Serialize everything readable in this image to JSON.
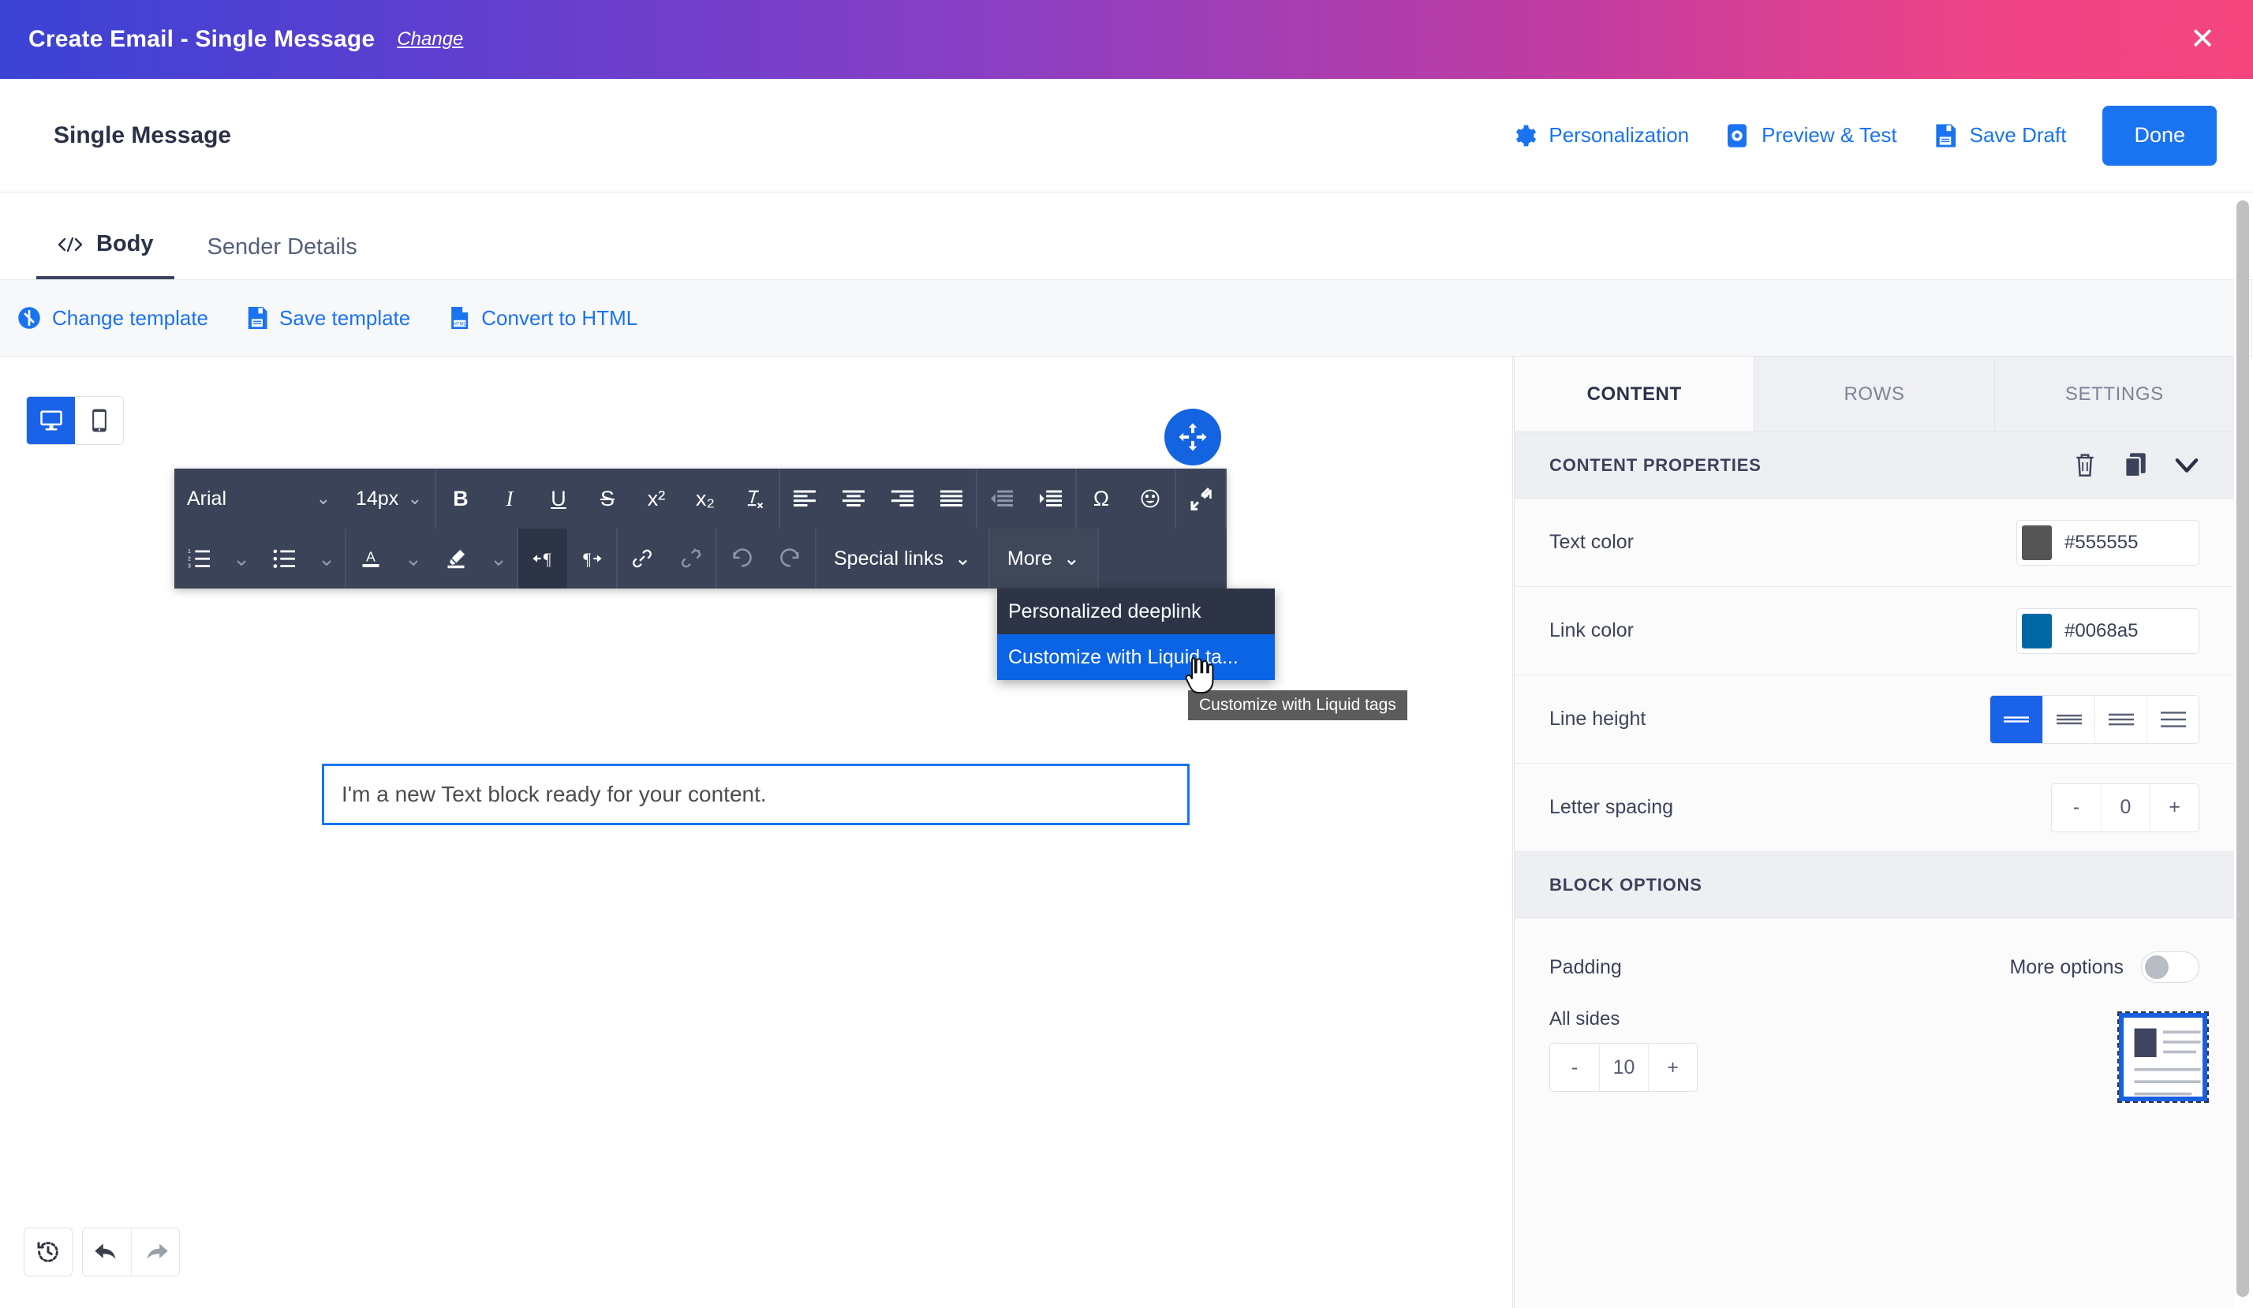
{
  "topbar": {
    "title": "Create Email - Single Message",
    "change_label": "Change",
    "close_icon": "close-icon"
  },
  "actionbar": {
    "title": "Single Message",
    "items": [
      {
        "label": "Personalization",
        "icon": "gear-icon"
      },
      {
        "label": "Preview & Test",
        "icon": "preview-device-icon"
      },
      {
        "label": "Save Draft",
        "icon": "floppy-disk-icon"
      }
    ],
    "done_label": "Done"
  },
  "tabs": [
    {
      "label": "Body",
      "icon": "code-icon",
      "active": true
    },
    {
      "label": "Sender Details",
      "icon": "",
      "active": false
    }
  ],
  "template_bar": [
    {
      "label": "Change template",
      "icon": "refresh-circle-icon"
    },
    {
      "label": "Save template",
      "icon": "floppy-disk-icon"
    },
    {
      "label": "Convert to HTML",
      "icon": "html-file-icon"
    }
  ],
  "canvas": {
    "device_toggle": [
      {
        "name": "desktop",
        "icon": "desktop-icon",
        "active": true
      },
      {
        "name": "mobile",
        "icon": "mobile-icon",
        "active": false
      }
    ],
    "text_block": "I'm a new Text block ready for your content.",
    "drag_handle_icon": "move-arrows-icon",
    "history_icon": "history-clock-icon",
    "undo_icon": "undo-arrow-icon",
    "redo_icon": "redo-arrow-icon"
  },
  "rte": {
    "font_family": "Arial",
    "font_size": "14px",
    "row1": [
      {
        "name": "bold",
        "glyph": "B"
      },
      {
        "name": "italic",
        "glyph": "I"
      },
      {
        "name": "underline",
        "glyph": "U"
      },
      {
        "name": "strikethrough",
        "glyph": "S"
      },
      {
        "name": "superscript",
        "glyph": "x²"
      },
      {
        "name": "subscript",
        "glyph": "x₂"
      },
      {
        "name": "remove-format",
        "glyph": "Ix"
      },
      {
        "name": "align-left",
        "glyph": ""
      },
      {
        "name": "align-center",
        "glyph": ""
      },
      {
        "name": "align-right",
        "glyph": ""
      },
      {
        "name": "align-justify",
        "glyph": ""
      },
      {
        "name": "outdent",
        "glyph": ""
      },
      {
        "name": "indent",
        "glyph": ""
      },
      {
        "name": "special-character",
        "glyph": "Ω"
      },
      {
        "name": "emoji",
        "glyph": "☺"
      },
      {
        "name": "collapse-toolbar",
        "glyph": ""
      }
    ],
    "row2": [
      {
        "name": "ordered-list",
        "glyph": ""
      },
      {
        "name": "ordered-list-options",
        "glyph": "⌄"
      },
      {
        "name": "unordered-list",
        "glyph": ""
      },
      {
        "name": "unordered-list-options",
        "glyph": "⌄"
      },
      {
        "name": "text-color",
        "glyph": "A"
      },
      {
        "name": "text-color-options",
        "glyph": "⌄"
      },
      {
        "name": "highlight-color",
        "glyph": ""
      },
      {
        "name": "highlight-color-options",
        "glyph": "⌄"
      },
      {
        "name": "ltr-direction",
        "glyph": ""
      },
      {
        "name": "rtl-direction",
        "glyph": ""
      },
      {
        "name": "insert-link",
        "glyph": ""
      },
      {
        "name": "unlink",
        "glyph": ""
      },
      {
        "name": "undo",
        "glyph": ""
      },
      {
        "name": "redo",
        "glyph": ""
      }
    ],
    "special_links_label": "Special links",
    "more_label": "More"
  },
  "menu": {
    "items": [
      {
        "label": "Personalized deeplink",
        "selected": false
      },
      {
        "label": "Customize with Liquid ta...",
        "selected": true
      }
    ],
    "tooltip": "Customize with Liquid tags"
  },
  "panel": {
    "tabs": [
      {
        "label": "CONTENT",
        "active": true
      },
      {
        "label": "ROWS",
        "active": false
      },
      {
        "label": "SETTINGS",
        "active": false
      }
    ],
    "content_properties": {
      "heading": "CONTENT PROPERTIES",
      "icons": [
        {
          "name": "trash-icon"
        },
        {
          "name": "duplicate-icon"
        },
        {
          "name": "chevron-down-icon"
        }
      ],
      "rows": [
        {
          "label": "Text color",
          "value": "#555555",
          "swatch": "#555555"
        },
        {
          "label": "Link color",
          "value": "#0068a5",
          "swatch": "#0068a5"
        }
      ],
      "line_height": {
        "label": "Line height",
        "options": [
          "tight",
          "normal",
          "loose",
          "extra-loose"
        ],
        "selected_index": 0
      },
      "letter_spacing": {
        "label": "Letter spacing",
        "minus": "-",
        "value": "0",
        "plus": "+"
      }
    },
    "block_options": {
      "heading": "BLOCK OPTIONS",
      "padding_label": "Padding",
      "more_options_label": "More options",
      "more_options_on": false,
      "all_sides_label": "All sides",
      "padding": {
        "minus": "-",
        "value": "10",
        "plus": "+"
      }
    }
  },
  "colors": {
    "accent_blue": "#1a73f0",
    "toolbar_dark": "#3a4357",
    "menu_dark": "#2c3446",
    "menu_selected": "#0b63e5"
  }
}
